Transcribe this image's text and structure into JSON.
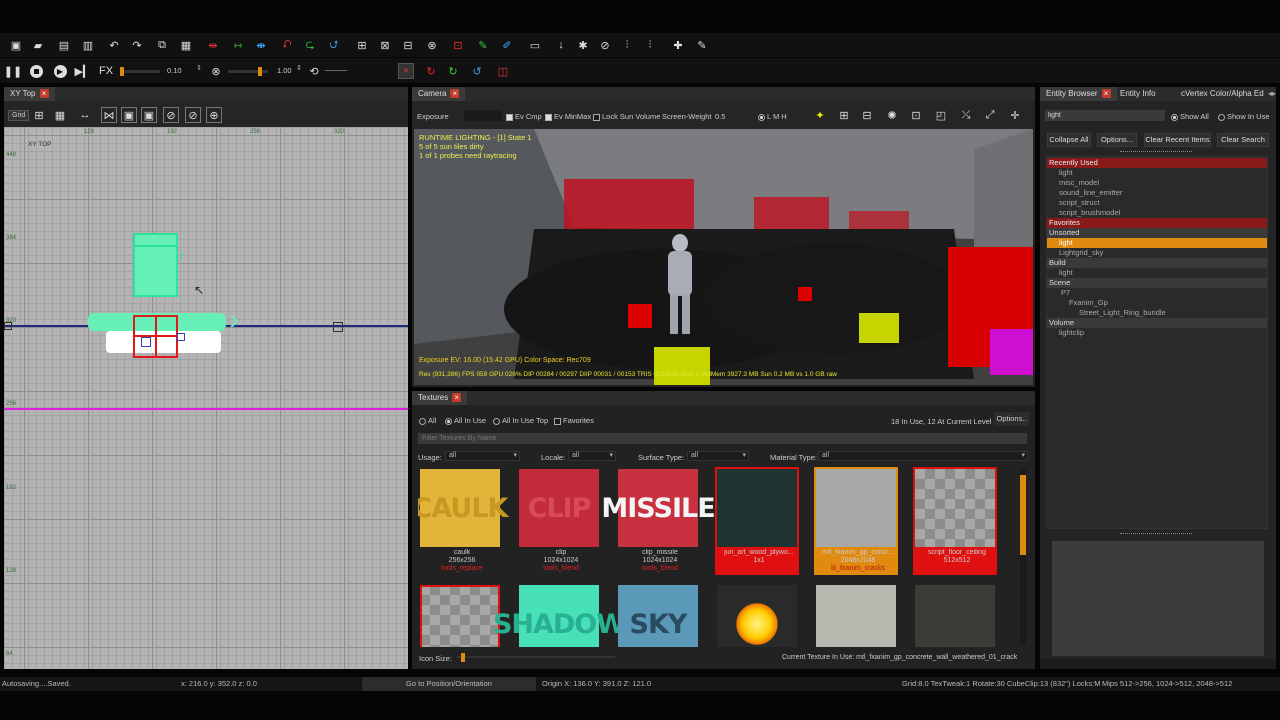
{
  "toolbar": {
    "speed_value": "0.10",
    "scale_value": "1.00"
  },
  "xy": {
    "tab": "XY Top",
    "grid_label": "Grid",
    "view_label": "XY TOP",
    "col_labels": [
      "128",
      "192",
      "256",
      "320"
    ],
    "row_labels": [
      "448",
      "384",
      "320",
      "256",
      "192",
      "128",
      "64"
    ]
  },
  "camera": {
    "tab": "Camera",
    "exposure_label": "Exposure",
    "ev_cmp": "Ev Cmp",
    "ev_minmax": "Ev MinMax",
    "lock_sun": "Lock Sun Volume",
    "screen_weight_label": "Screen-Weight",
    "screen_weight_value": "0.5",
    "lmh": "L  M  H",
    "overlay": [
      "RUNTIME LIGHTING - [1] State 1",
      "5 of 5 sun tiles dirty",
      "1 of 1 probes need raytracing"
    ],
    "exposure_info": "Exposure EV: 16.00 (15.42 GPU)   Color Space: Rec709",
    "stats": "Res (931,386)   FPS 059   GPU 026%   DIP 00284 / 00297   DIIP 00031 / 00153   TRIS 0126539   BCU 0   VidMem 3927.3 MB   Sun 0.2 MB vs 1.0 GB raw"
  },
  "textures": {
    "tab": "Textures",
    "filter_all": "All",
    "filter_in_use": "All In Use",
    "filter_in_use_top": "All In Use Top",
    "filter_fav": "Favorites",
    "count_text": "18 In Use, 12 At Current Level",
    "options": "Options..",
    "search_placeholder": "Filter Textures By Name",
    "usage_label": "Usage:",
    "usage_val": "all",
    "locale_label": "Locale:",
    "locale_val": "all",
    "surface_label": "Surface Type:",
    "surface_val": "all",
    "material_label": "Material Type:",
    "material_val": "all",
    "items": [
      {
        "label": "CAULK",
        "name": "caulk",
        "size": "256x256",
        "sub": "tools_replace"
      },
      {
        "label": "CLIP",
        "name": "clip",
        "size": "1024x1024",
        "sub": "tools_blend"
      },
      {
        "label": "MISSILE",
        "name": "clip_missile",
        "size": "1024x1024",
        "sub": "tools_blend"
      },
      {
        "label": "",
        "name": "jun_art_wood_plywo...",
        "size": "1x1",
        "sub": ""
      },
      {
        "label": "",
        "name": "mtl_fxanim_gp_concr...",
        "size": "2048x2048",
        "sub": "lit_fxanim_cracks"
      },
      {
        "label": "",
        "name": "script_floor_ceiling",
        "size": "512x512",
        "sub": ""
      },
      {
        "label": "",
        "name": "",
        "size": "",
        "sub": ""
      },
      {
        "label": "SHADOW",
        "name": "",
        "size": "",
        "sub": ""
      },
      {
        "label": "SKY",
        "name": "",
        "size": "",
        "sub": ""
      },
      {
        "label": "",
        "name": "",
        "size": "",
        "sub": ""
      },
      {
        "label": "",
        "name": "",
        "size": "",
        "sub": ""
      },
      {
        "label": "",
        "name": "",
        "size": "",
        "sub": ""
      }
    ],
    "icon_size_label": "Icon Size:",
    "current_texture": "Current Texture In Use: mtl_fxanim_gp_concrete_wall_weathered_01_crack"
  },
  "entity": {
    "tabs": [
      "Entity Browser",
      "Entity Info",
      "cVertex Color/Alpha Ed"
    ],
    "search_value": "light",
    "show_all": "Show All",
    "show_in_use": "Show In Use",
    "btn_collapse": "Collapse All",
    "btn_options": "Options...",
    "btn_clear_recent": "Clear Recent Items",
    "btn_clear_search": "Clear Search",
    "tree": [
      {
        "t": "Recently Used",
        "k": "headred"
      },
      {
        "t": "light",
        "k": "item"
      },
      {
        "t": "misc_model",
        "k": "item"
      },
      {
        "t": "sound_line_emitter",
        "k": "item"
      },
      {
        "t": "script_struct",
        "k": "item"
      },
      {
        "t": "script_brushmodel",
        "k": "item"
      },
      {
        "t": "Favorites",
        "k": "headred"
      },
      {
        "t": "Unsorted",
        "k": "head"
      },
      {
        "t": "light",
        "k": "sel"
      },
      {
        "t": "Lightgrid_sky",
        "k": "item"
      },
      {
        "t": "Build",
        "k": "head"
      },
      {
        "t": "light",
        "k": "item"
      },
      {
        "t": "Scene",
        "k": "head"
      },
      {
        "t": "P7",
        "k": "item2"
      },
      {
        "t": "Fxanim_Gp",
        "k": "item3"
      },
      {
        "t": "Street_Light_Ring_bundle",
        "k": "item4"
      },
      {
        "t": "Volume",
        "k": "head"
      },
      {
        "t": "lightclip",
        "k": "item"
      }
    ]
  },
  "status": {
    "left": "Autosaving....Saved.",
    "coords": "x: 216.0  y: 352.0  z: 0.0",
    "goto": "Go to Position/Orientation",
    "origin": "Origin X: 136.0  Y: 391.0  Z: 121.0",
    "grid": "Grid:8.0 TexTweak:1 Rotate:30 CubeClip:13 (832\") Locks:M",
    "mips": "Mips 512->256, 1024->512, 2048->512"
  }
}
